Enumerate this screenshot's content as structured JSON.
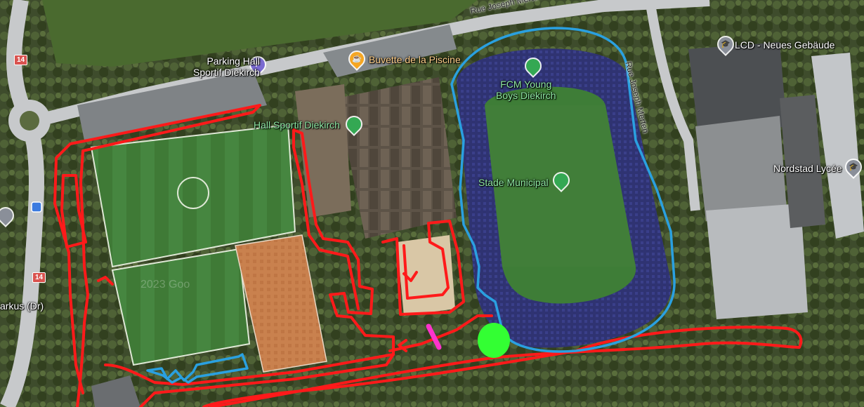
{
  "colors": {
    "route": "#ff1a1a",
    "blue_route": "#2aa0e0",
    "pink_mark": "#ff33cc",
    "green_mark": "#33ff33",
    "pin_green": "#34a853",
    "pin_purple": "#7b6bd1",
    "pin_orange": "#f5a623",
    "pin_gray": "#8a8f99"
  },
  "labels": {
    "parking_hall": "Parking Hall\nSportif Diekirch",
    "buvette": "Buvette de la Piscine",
    "hall_sportif": "Hall Sportif Diekirch",
    "fcm": "FCM Young\nBoys Diekirch",
    "stade": "Stade Municipal",
    "lcd": "LCD - Neues Gebäude",
    "nordstad": "Nordstad Lycée",
    "arkus": "arkus (Dr)",
    "road_top": "Rue Joseph Merten",
    "road_right": "Rue Joseph Merten",
    "route_14_a": "14",
    "route_14_b": "14",
    "watermark": "2023 Goo"
  },
  "icons": {
    "parking": "parking-icon",
    "cafe": "cafe-icon",
    "stadium": "stadium-icon",
    "school": "school-icon",
    "bus": "bus-stop-icon"
  },
  "pin_glyphs": {
    "parking": "P",
    "cafe": "☕",
    "bus": "🚌",
    "school": "🎓"
  }
}
